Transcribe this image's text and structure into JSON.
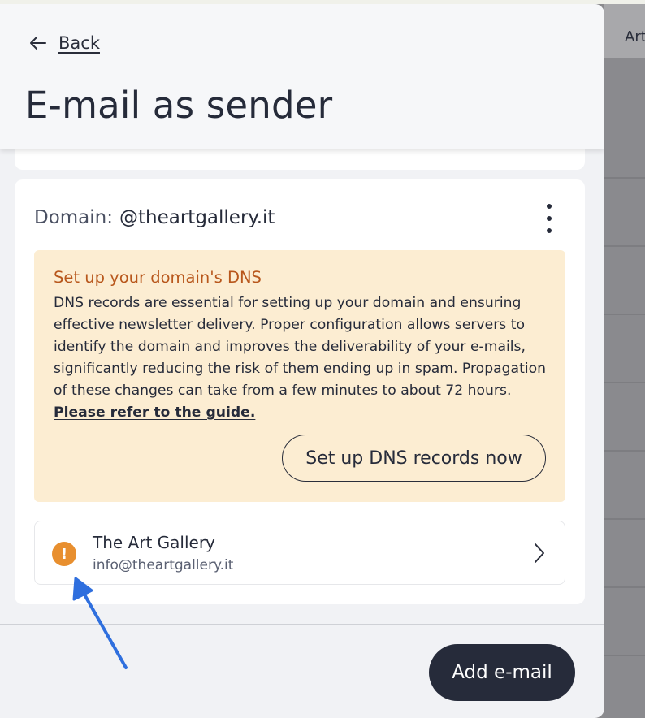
{
  "background": {
    "header_text": "Art"
  },
  "panel": {
    "back_label": "Back",
    "title": "E-mail as sender"
  },
  "domain_card": {
    "label": "Domain:",
    "value": "@theartgallery.it",
    "menu_icon": "kebab-menu-icon"
  },
  "dns_alert": {
    "title": "Set up your domain's DNS",
    "body": "DNS records are essential for setting up your domain and ensuring effective newsletter delivery. Proper configuration allows servers to identify the domain and improves the deliverability of your e-mails, significantly reducing the risk of them ending up in spam. Propagation of these changes can take from a few minutes to about 72 hours.",
    "guide_link": "Please refer to the guide.",
    "button_label": "Set up DNS records now",
    "title_color": "#b8571c",
    "background_color": "#fcedd2"
  },
  "sender": {
    "name": "The Art Gallery",
    "email": "info@theartgallery.it",
    "status_icon": "warning-icon",
    "status_color": "#e88f2f"
  },
  "footer": {
    "add_button_label": "Add e-mail"
  },
  "annotation": {
    "arrow_color": "#2f6fde"
  }
}
